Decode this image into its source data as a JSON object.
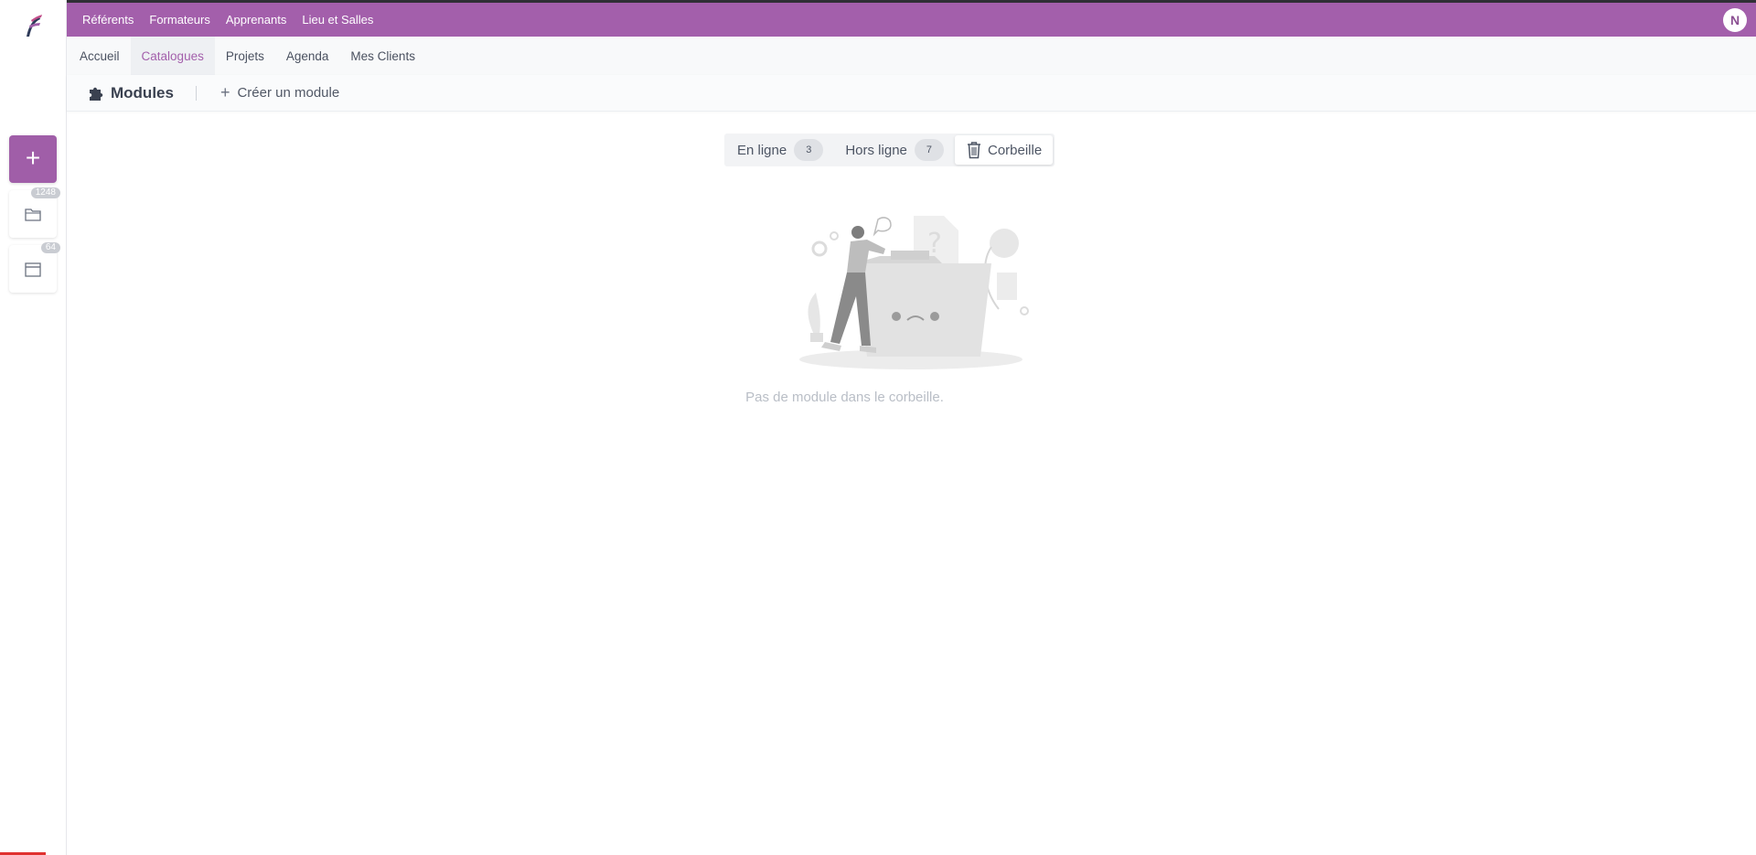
{
  "top_nav": {
    "items": [
      {
        "label": "Référents"
      },
      {
        "label": "Formateurs"
      },
      {
        "label": "Apprenants"
      },
      {
        "label": "Lieu et Salles"
      }
    ],
    "avatar_initial": "N"
  },
  "sub_nav": {
    "items": [
      {
        "label": "Accueil"
      },
      {
        "label": "Catalogues",
        "active": true
      },
      {
        "label": "Projets"
      },
      {
        "label": "Agenda"
      },
      {
        "label": "Mes Clients"
      }
    ]
  },
  "sidebar": {
    "add_label": "+",
    "folder_count": "1248",
    "calendar_count": "64"
  },
  "page": {
    "title": "Modules",
    "create_label": "Créer un module"
  },
  "tabs": [
    {
      "label": "En ligne",
      "count": "3"
    },
    {
      "label": "Hors ligne",
      "count": "7"
    },
    {
      "label": "Corbeille",
      "active": true
    }
  ],
  "empty_state": {
    "message": "Pas de module dans le corbeille."
  },
  "colors": {
    "brand": "#a35fab",
    "accent_red": "#e0312f"
  }
}
